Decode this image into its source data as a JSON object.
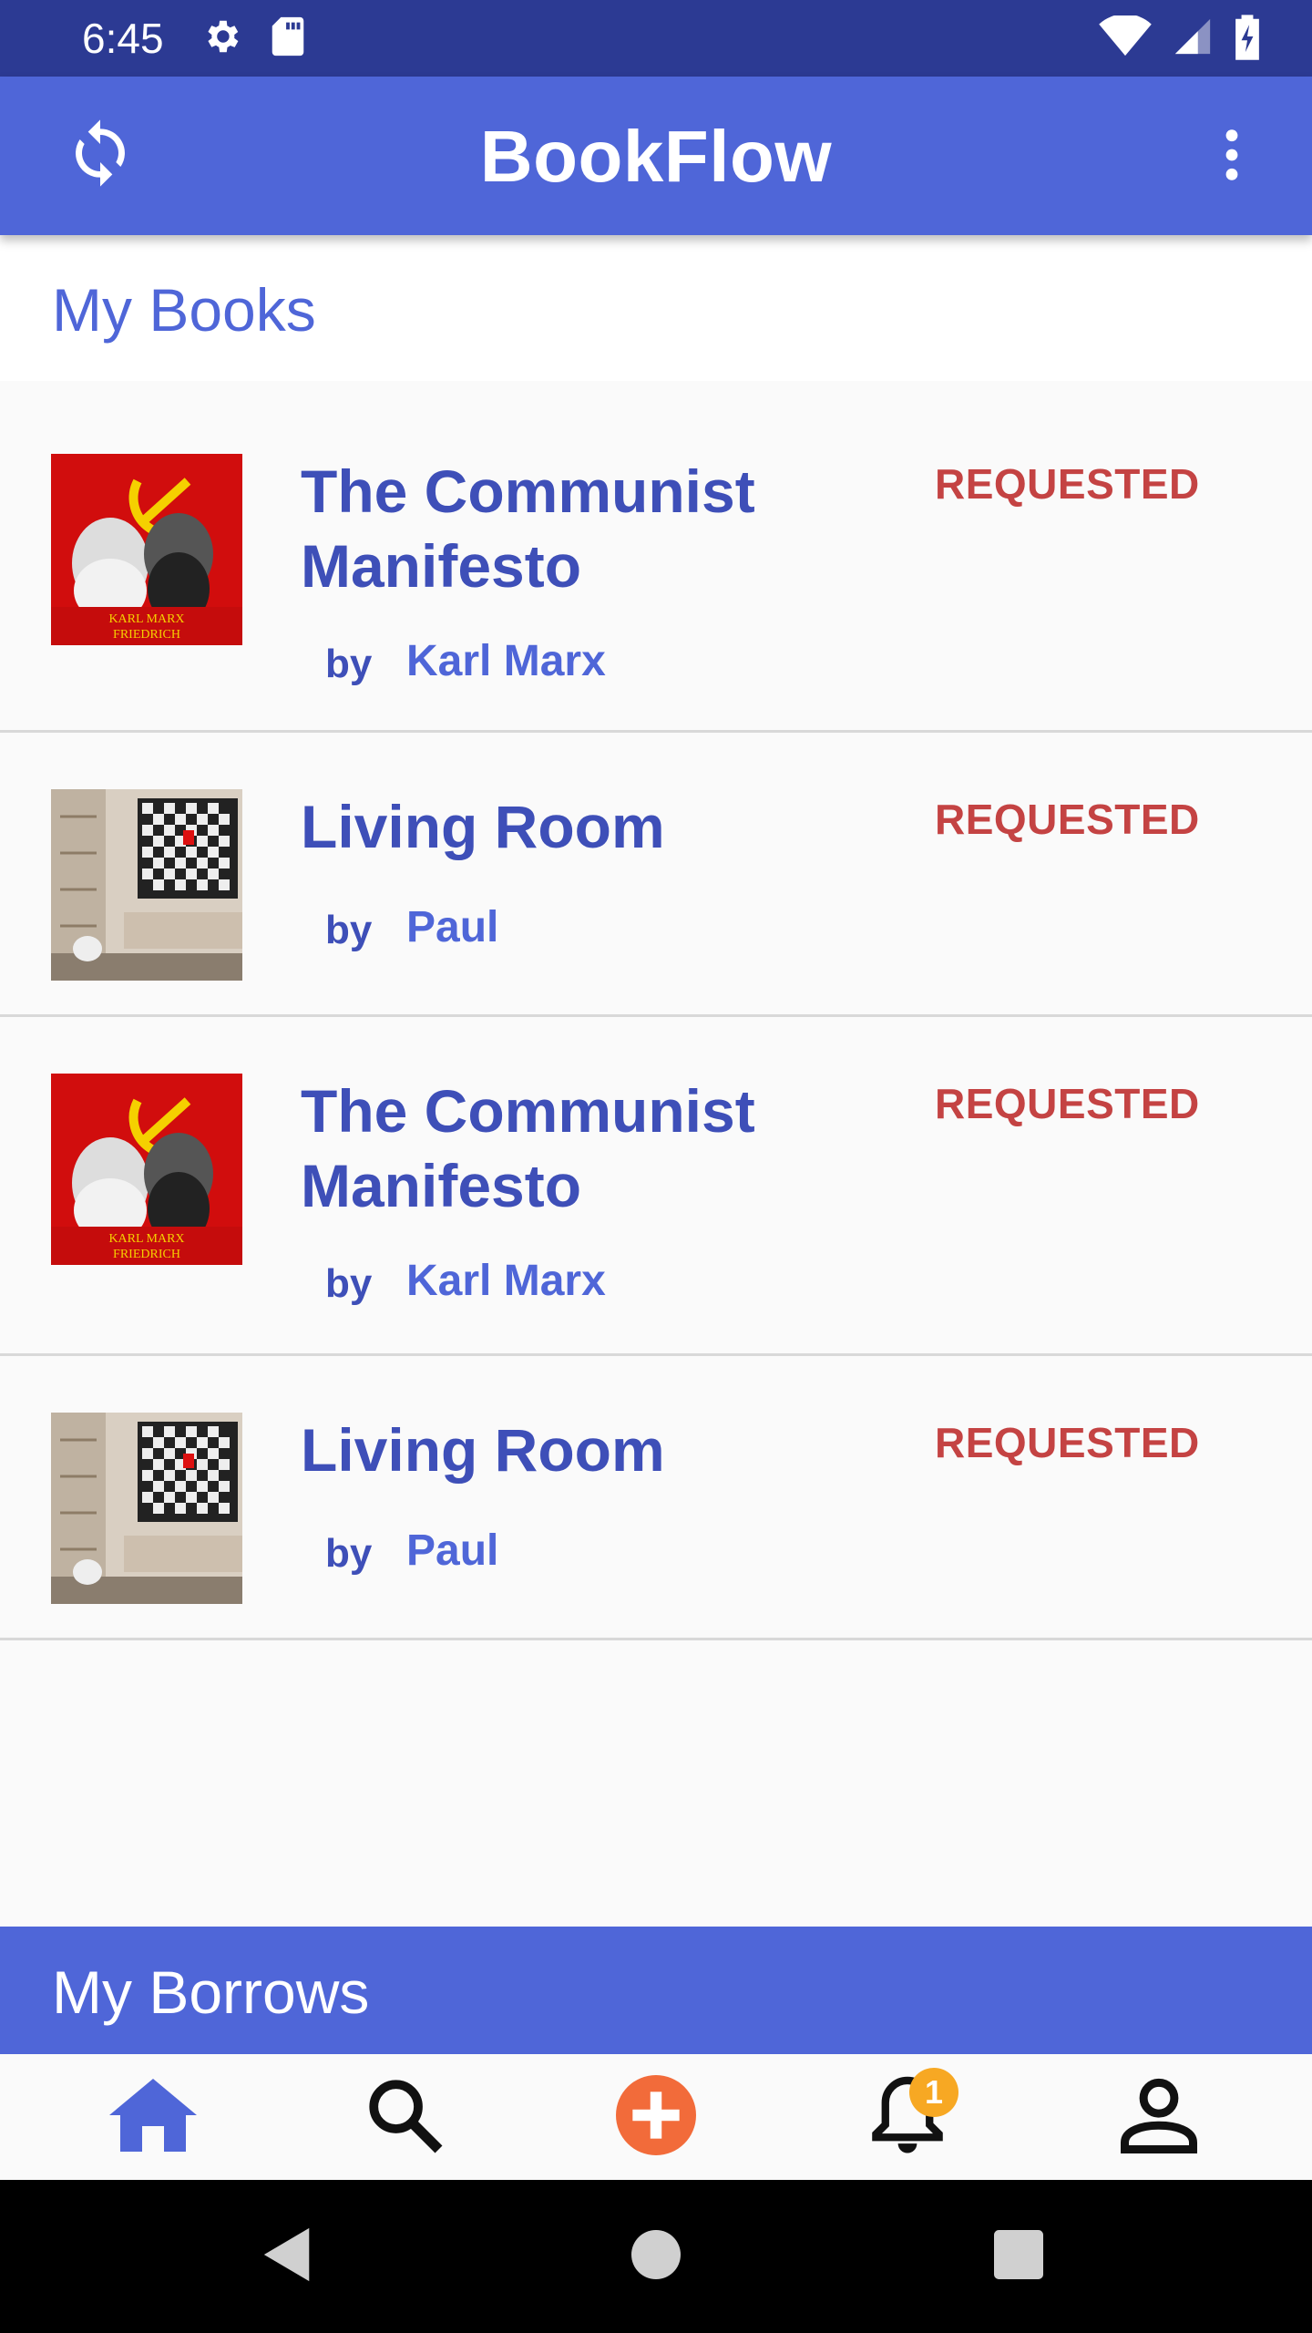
{
  "status_bar": {
    "time": "6:45",
    "icons_left": [
      "settings-icon",
      "sd-card-icon"
    ],
    "icons_right": [
      "wifi-icon",
      "cell-signal-icon",
      "battery-charging-icon"
    ]
  },
  "app_bar": {
    "title": "BookFlow",
    "left_icon": "refresh-icon",
    "right_icon": "more-vert-icon"
  },
  "my_books": {
    "title": "My Books",
    "items": [
      {
        "title": "The Communist Manifesto",
        "by": "by",
        "author": "Karl Marx",
        "status": "REQUESTED",
        "cover": "communist-manifesto-cover"
      },
      {
        "title": "Living Room",
        "by": "by",
        "author": "Paul",
        "status": "REQUESTED",
        "cover": "living-room-cover"
      },
      {
        "title": "The Communist Manifesto",
        "by": "by",
        "author": "Karl Marx",
        "status": "REQUESTED",
        "cover": "communist-manifesto-cover"
      },
      {
        "title": "Living Room",
        "by": "by",
        "author": "Paul",
        "status": "REQUESTED",
        "cover": "living-room-cover"
      }
    ]
  },
  "my_borrows": {
    "title": "My Borrows"
  },
  "bottom_nav": {
    "items": [
      "home-icon",
      "search-icon",
      "add-icon",
      "notifications-icon",
      "profile-icon"
    ],
    "notification_count": "1",
    "active": "home"
  },
  "colors": {
    "primary": "#4f66d8",
    "status_bar": "#2c3a93",
    "title_text": "#3e4fb8",
    "requested": "#c44343",
    "add_button": "#f26b3a",
    "badge": "#f7a823"
  }
}
